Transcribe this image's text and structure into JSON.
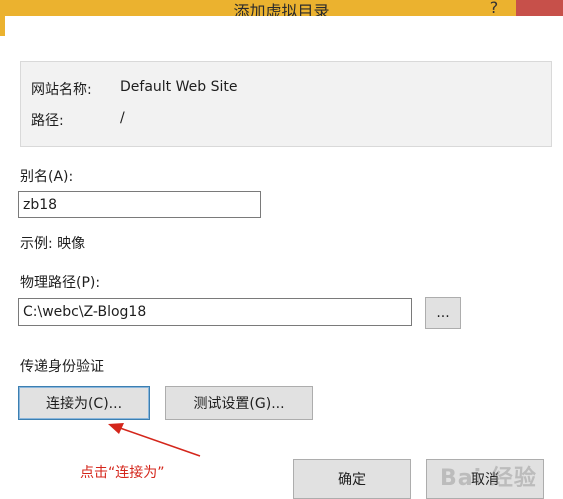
{
  "window": {
    "title": "添加虚拟目录",
    "help_glyph": "?"
  },
  "info": {
    "site_name_label": "网站名称:",
    "site_name_value": "Default Web Site",
    "path_label": "路径:",
    "path_value": "/"
  },
  "alias": {
    "label": "别名(A):",
    "value": "zb18",
    "example": "示例: 映像"
  },
  "physical_path": {
    "label": "物理路径(P):",
    "value": "C:\\webc\\Z-Blog18",
    "browse_label": "..."
  },
  "pass_through": {
    "label": "传递身份验证",
    "connect_as_label": "连接为(C)...",
    "test_settings_label": "测试设置(G)..."
  },
  "footer": {
    "ok_label": "确定",
    "cancel_label": "取消"
  },
  "annotation": {
    "text": "点击“连接为”",
    "color": "#d4261b"
  },
  "watermark": {
    "text": "Bai 经验"
  },
  "colors": {
    "titlebar": "#ebb22f",
    "close": "#c7504a"
  }
}
